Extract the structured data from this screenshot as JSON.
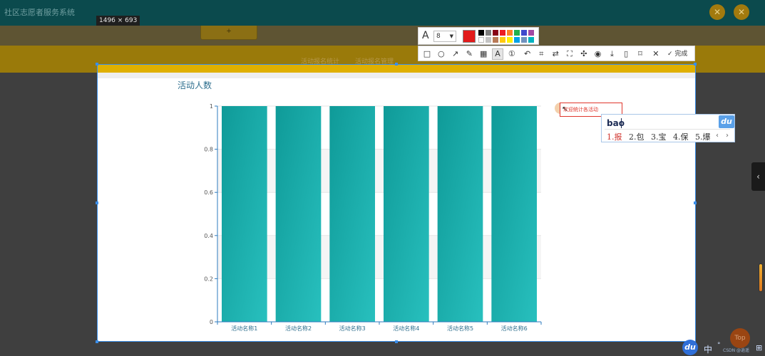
{
  "app": {
    "title": "社区志愿者服务系统",
    "header_buttons": [
      "✕",
      "✕"
    ],
    "ghost_button": "+",
    "breadcrumb_left": "活动报名统计",
    "breadcrumb_right": "活动报名管理"
  },
  "screenshot": {
    "dimension_label": "1496 × 693"
  },
  "annotation": {
    "text": "欢迎统计各活动"
  },
  "toolbar": {
    "font_icon": "A",
    "font_size": "8",
    "current_color": "#e21b1b",
    "palette": [
      "#000000",
      "#7f7f7f",
      "#880015",
      "#ed1c24",
      "#ff7f27",
      "#22b14c",
      "#3f48cc",
      "#a349a4",
      "#ffffff",
      "#c3c3c3",
      "#b97a57",
      "#ffc90e",
      "#fff200",
      "#00a2e8",
      "#7092be",
      "#00b2bf"
    ],
    "tools": [
      {
        "name": "rectangle-tool-icon",
        "glyph": "□"
      },
      {
        "name": "ellipse-tool-icon",
        "glyph": "○"
      },
      {
        "name": "arrow-tool-icon",
        "glyph": "↗"
      },
      {
        "name": "pen-tool-icon",
        "glyph": "✎"
      },
      {
        "name": "mosaic-tool-icon",
        "glyph": "▦"
      },
      {
        "name": "text-tool-icon",
        "glyph": "A",
        "active": true
      },
      {
        "name": "number-tool-icon",
        "glyph": "①"
      },
      {
        "name": "undo-icon",
        "glyph": "↶"
      },
      {
        "name": "ocr-icon",
        "glyph": "⌗"
      },
      {
        "name": "translate-icon",
        "glyph": "⇄"
      },
      {
        "name": "scan-icon",
        "glyph": "⛶"
      },
      {
        "name": "pin-icon",
        "glyph": "✣"
      },
      {
        "name": "record-icon",
        "glyph": "◉"
      },
      {
        "name": "download-icon",
        "glyph": "⤓"
      },
      {
        "name": "phone-icon",
        "glyph": "▯"
      },
      {
        "name": "bookmark-icon",
        "glyph": "⌑"
      },
      {
        "name": "close-icon",
        "glyph": "✕"
      }
    ],
    "done_label": "完成"
  },
  "ime": {
    "input": "bao",
    "logo": "du",
    "candidates": [
      "1.报",
      "2.包",
      "3.宝",
      "4.保",
      "5.爆"
    ],
    "prev": "‹",
    "next": "›"
  },
  "side": {
    "collapse_glyph": "‹",
    "top_label": "Top"
  },
  "tray": {
    "du": "du",
    "zh": "中",
    "dot": "°",
    "text": "CSDN @逍遥",
    "grid": "⊞"
  },
  "chart_data": {
    "type": "bar",
    "title": "活动人数",
    "categories": [
      "活动名称1",
      "活动名称2",
      "活动名称3",
      "活动名称4",
      "活动名称5",
      "活动名称6"
    ],
    "values": [
      1,
      1,
      1,
      1,
      1,
      1
    ],
    "yticks": [
      "0",
      "0.2",
      "0.4",
      "0.6",
      "0.8",
      "1"
    ],
    "ylim": [
      0,
      1
    ],
    "grid": true,
    "bar_color_top": "#0f9a98",
    "bar_color_bottom": "#28c0be",
    "axis_color": "#2e7bbf"
  }
}
